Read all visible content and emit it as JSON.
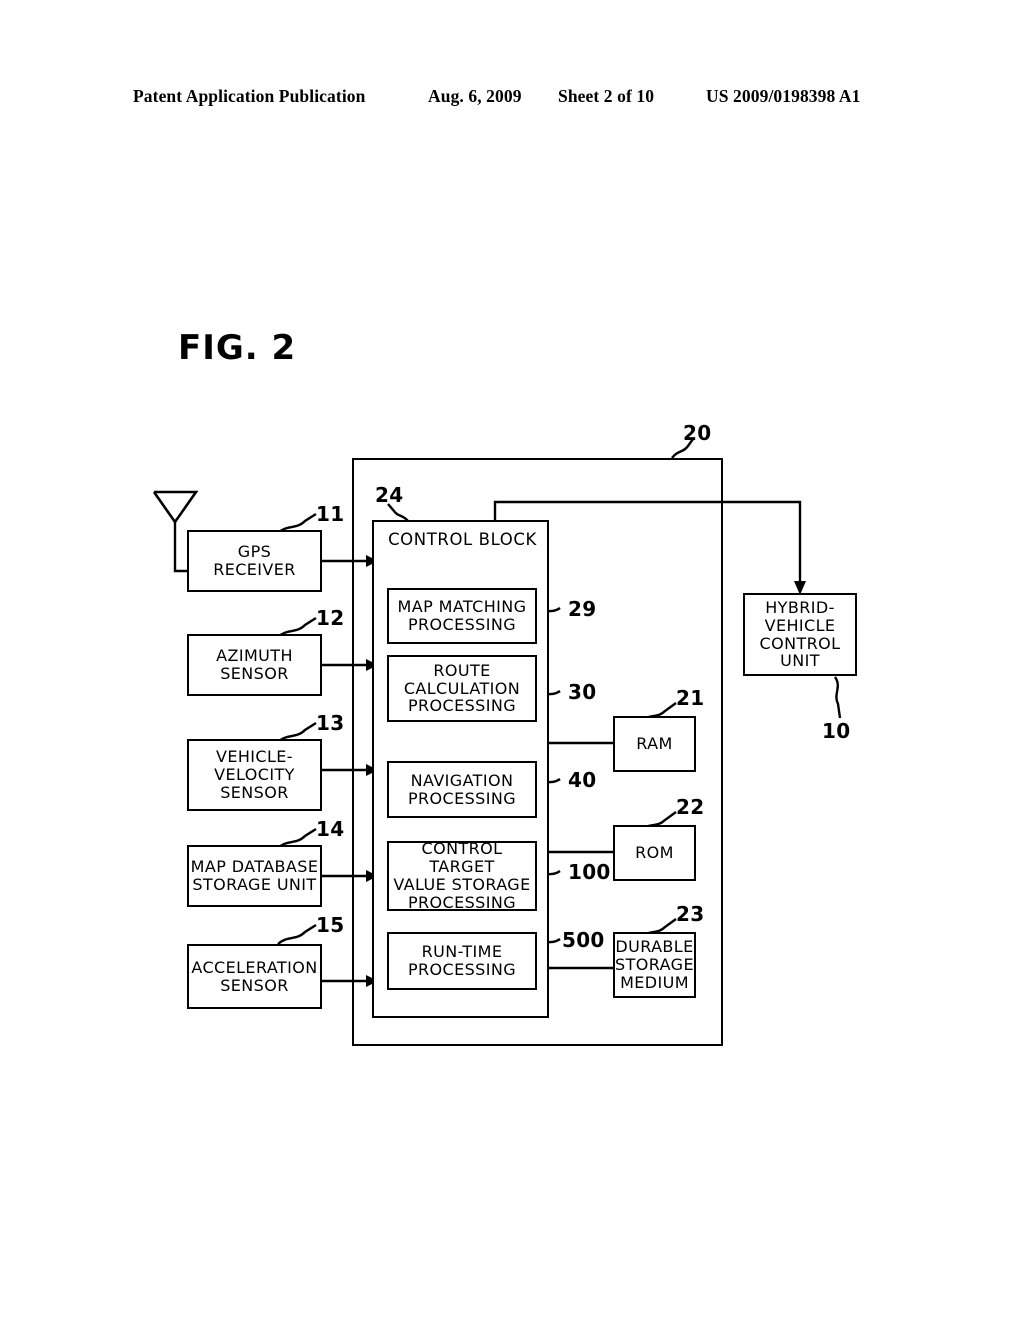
{
  "header": {
    "publication": "Patent Application Publication",
    "date": "Aug. 6, 2009",
    "sheet": "Sheet 2 of 10",
    "patent_number": "US 2009/0198398 A1"
  },
  "figure": {
    "title": "FIG. 2",
    "system_ref": "20",
    "external_ref": "10"
  },
  "inputs": [
    {
      "label": "GPS\nRECEIVER",
      "ref": "11"
    },
    {
      "label": "AZIMUTH\nSENSOR",
      "ref": "12"
    },
    {
      "label": "VEHICLE-\nVELOCITY\nSENSOR",
      "ref": "13"
    },
    {
      "label": "MAP DATABASE\nSTORAGE UNIT",
      "ref": "14"
    },
    {
      "label": "ACCELERATION\nSENSOR",
      "ref": "15"
    }
  ],
  "control_block": {
    "label": "CONTROL BLOCK",
    "ref": "24",
    "processes": [
      {
        "label": "MAP MATCHING\nPROCESSING",
        "ref": "29"
      },
      {
        "label": "ROUTE\nCALCULATION\nPROCESSING",
        "ref": "30"
      },
      {
        "label": "NAVIGATION\nPROCESSING",
        "ref": "40"
      },
      {
        "label": "CONTROL TARGET\nVALUE STORAGE\nPROCESSING",
        "ref": "100"
      },
      {
        "label": "RUN-TIME\nPROCESSING",
        "ref": "500"
      }
    ]
  },
  "memories": [
    {
      "label": "RAM",
      "ref": "21"
    },
    {
      "label": "ROM",
      "ref": "22"
    },
    {
      "label": "DURABLE\nSTORAGE\nMEDIUM",
      "ref": "23"
    }
  ],
  "external_unit": {
    "label": "HYBRID-\nVEHICLE\nCONTROL\nUNIT",
    "ref": "10"
  },
  "icons": {
    "antenna": "antenna-icon"
  },
  "colors": {
    "ink": "#000000",
    "paper": "#ffffff"
  }
}
